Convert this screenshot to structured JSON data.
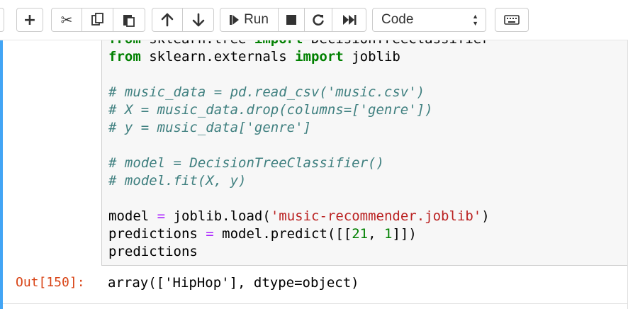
{
  "toolbar": {
    "run_label": "Run",
    "cell_type": "Code",
    "icons": [
      "plus-icon",
      "scissors-icon",
      "copy-icon",
      "paste-icon",
      "arrow-up-icon",
      "arrow-down-icon",
      "run-icon",
      "stop-icon",
      "restart-icon",
      "fast-forward-icon",
      "keyboard-icon"
    ]
  },
  "code": {
    "line0": {
      "kw1": "from",
      "t1": " sklearn.tree ",
      "kw2": "import",
      "t2": " DecisionTreeClassifier"
    },
    "line1": {
      "kw1": "from",
      "t1": " sklearn.externals ",
      "kw2": "import",
      "t2": " joblib"
    },
    "line3": "# music_data = pd.read_csv('music.csv')",
    "line4": "# X = music_data.drop(columns=['genre'])",
    "line5": "# y = music_data['genre']",
    "line7": "# model = DecisionTreeClassifier()",
    "line8": "# model.fit(X, y)",
    "line10": {
      "a": "model ",
      "eq": "=",
      "b": " joblib.load(",
      "s": "'music-recommender.joblib'",
      "c": ")"
    },
    "line11": {
      "a": "predictions ",
      "eq": "=",
      "b": " model.predict([[",
      "n1": "21",
      "c": ", ",
      "n2": "1",
      "d": "]])"
    },
    "line12": "predictions"
  },
  "output": {
    "prompt": "Out[150]:",
    "text": "array(['HipHop'], dtype=object)"
  },
  "colors": {
    "accent": "#42a5f5",
    "keyword": "#008000",
    "comment": "#408080",
    "string": "#ba2121",
    "operator": "#aa22ff",
    "out_prompt": "#d84315"
  }
}
